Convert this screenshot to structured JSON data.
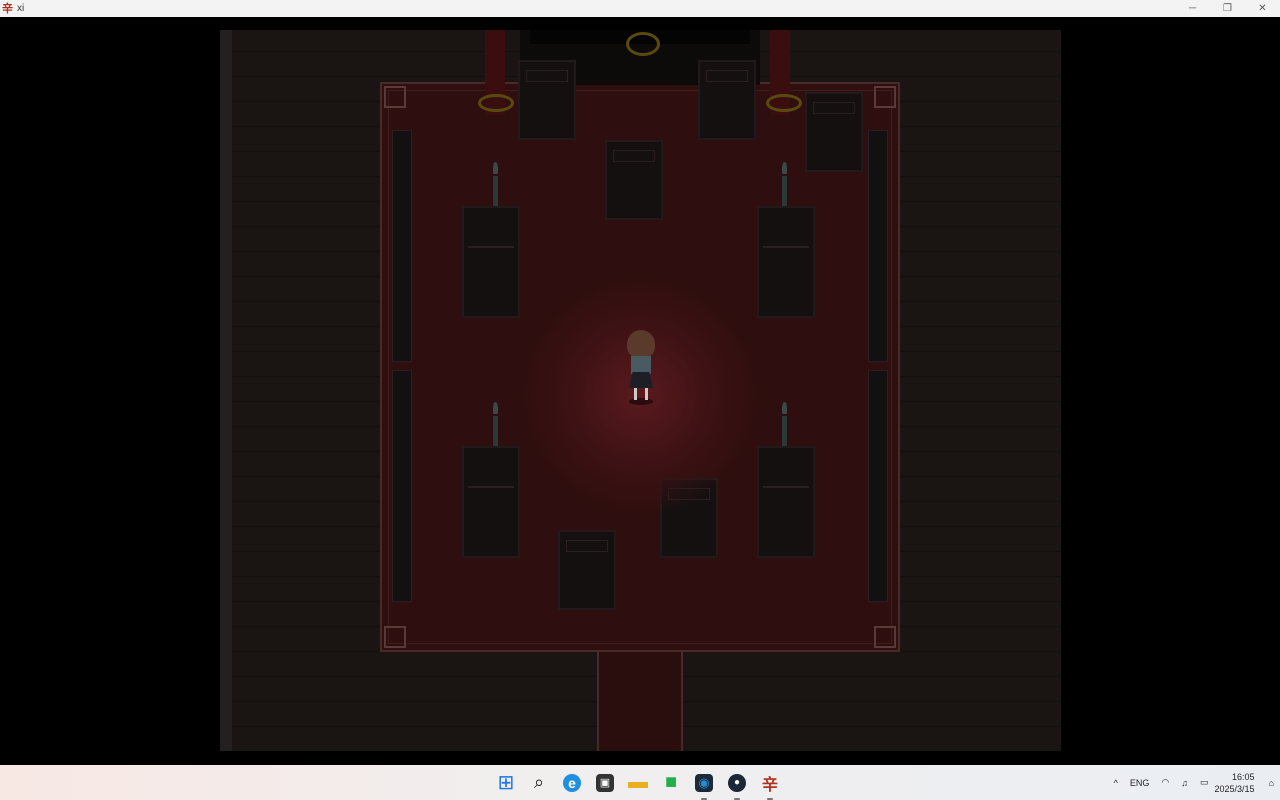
{
  "window": {
    "title": "xi",
    "app_icon_glyph": "辛",
    "controls": {
      "minimize": "─",
      "restore": "❐",
      "close": "✕"
    }
  },
  "game": {
    "scene": "red-carpet-hall",
    "colors": {
      "carpet": "#2e0e0e",
      "glow": "#5a1a1e",
      "floor": "#1a1413"
    }
  },
  "taskbar": {
    "apps": [
      {
        "name": "start",
        "glyph": "⊞",
        "color": "#1a73e8"
      },
      {
        "name": "search",
        "glyph": "⌕",
        "color": "#222222"
      },
      {
        "name": "edge",
        "glyph": "e",
        "color": "#1f8fe0"
      },
      {
        "name": "app-box",
        "glyph": "▣",
        "color": "#333333"
      },
      {
        "name": "file-explorer",
        "glyph": "▬",
        "color": "#e8b020"
      },
      {
        "name": "wechat-like",
        "glyph": "■",
        "color": "#22b04a"
      },
      {
        "name": "photo-app",
        "glyph": "◉",
        "color": "#1a2a3a"
      },
      {
        "name": "steam",
        "glyph": "●",
        "color": "#1b2838"
      },
      {
        "name": "game-xi",
        "glyph": "辛",
        "color": "#b03020"
      }
    ],
    "tray": {
      "chevron": "^",
      "language": "ENG",
      "wifi": "◠",
      "volume": "♫",
      "battery": "▭",
      "time": "16:05",
      "date": "2025/3/15",
      "notification": "⌂"
    }
  }
}
